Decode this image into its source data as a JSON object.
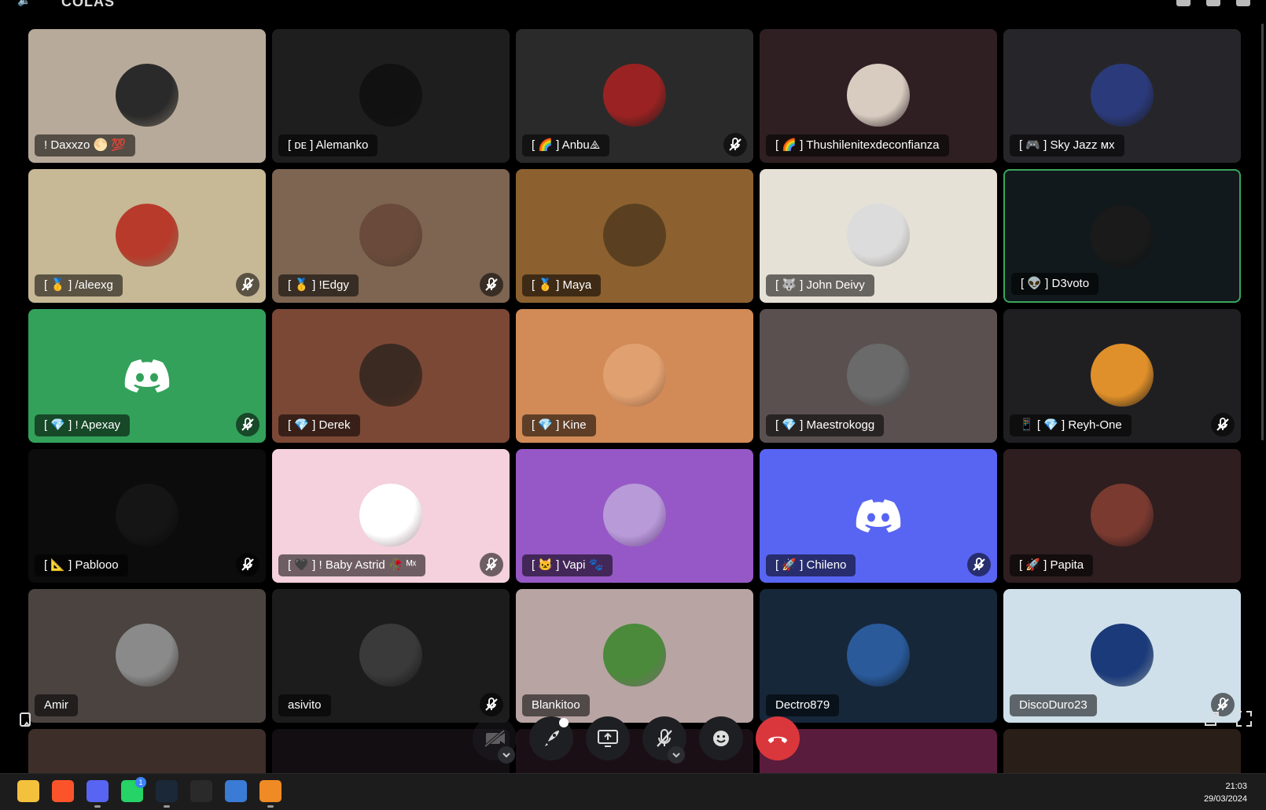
{
  "window": {
    "title": "COLAS"
  },
  "tiles": [
    {
      "name": "! Daxxzo 🌕 💯",
      "muted": false,
      "speaking": false,
      "bg": "#b8aa9a",
      "avatar_color": "#2a2a2a"
    },
    {
      "name": "[ ᴅᴇ ] Alemanko",
      "muted": false,
      "speaking": false,
      "bg": "#1e1e1e",
      "avatar_color": "#111111"
    },
    {
      "name": "[ 🌈 ] Anbu⧌",
      "muted": true,
      "speaking": false,
      "bg": "#2a2a2a",
      "avatar_color": "#9a2222"
    },
    {
      "name": "[ 🌈 ] Thushilenitexdeconfianza",
      "muted": false,
      "speaking": false,
      "bg": "#2f1f23",
      "avatar_color": "#d8ccc0"
    },
    {
      "name": "[ 🎮 ] Sky Jazz ᴍx",
      "muted": false,
      "speaking": false,
      "bg": "#26262a",
      "avatar_color": "#2b3a7a"
    },
    {
      "name": "[ 🥇 ] /aleexg",
      "muted": true,
      "speaking": false,
      "bg": "#c7b896",
      "avatar_color": "#b83a2a"
    },
    {
      "name": "[ 🥇 ] !Edgy",
      "muted": true,
      "speaking": false,
      "bg": "#7d6551",
      "avatar_color": "#6a4a3a"
    },
    {
      "name": "[ 🥇 ] Maya",
      "muted": false,
      "speaking": false,
      "bg": "#8c612f",
      "avatar_color": "#5a4020"
    },
    {
      "name": "[ 🐺 ] John Deivy",
      "muted": false,
      "speaking": false,
      "bg": "#e6e1d6",
      "avatar_color": "#dcdcdc"
    },
    {
      "name": "[ 👽 ] D3voto",
      "muted": false,
      "speaking": true,
      "bg": "#11191c",
      "avatar_color": "#1a1a1a"
    },
    {
      "name": "[ 💎 ] ! Apexay",
      "muted": true,
      "speaking": false,
      "bg": "#33a15a",
      "avatar_color": "discord"
    },
    {
      "name": "[ 💎 ] Derek",
      "muted": false,
      "speaking": false,
      "bg": "#7c4836",
      "avatar_color": "#3a2a22"
    },
    {
      "name": "[ 💎 ] Kine",
      "muted": false,
      "speaking": false,
      "bg": "#d28a57",
      "avatar_color": "#e0a070"
    },
    {
      "name": "[ 💎 ] Maestrokogg",
      "muted": false,
      "speaking": false,
      "bg": "#5a5050",
      "avatar_color": "#6a6a6a"
    },
    {
      "name": "📱 [ 💎 ] Reyh-One",
      "muted": true,
      "speaking": false,
      "bg": "#1f1f22",
      "avatar_color": "#e0902a"
    },
    {
      "name": "[ 📐 ] Pablooo",
      "muted": true,
      "speaking": false,
      "bg": "#0c0c0c",
      "avatar_color": "#151515"
    },
    {
      "name": "[ 🖤 ] ! Baby Astrid 🥀 ᴹˣ",
      "muted": true,
      "speaking": false,
      "bg": "#f4d1dc",
      "avatar_color": "#ffffff"
    },
    {
      "name": "[ 🐱 ] Vapi 🐾",
      "muted": false,
      "speaking": false,
      "bg": "#9658c6",
      "avatar_color": "#b89ad8"
    },
    {
      "name": "[ 🚀 ] Chileno",
      "muted": true,
      "speaking": false,
      "bg": "#5865f2",
      "avatar_color": "discord"
    },
    {
      "name": "[ 🚀 ] Papita",
      "muted": false,
      "speaking": false,
      "bg": "#2e1e20",
      "avatar_color": "#7a3a30"
    },
    {
      "name": "Amir",
      "muted": false,
      "speaking": false,
      "bg": "#4a4340",
      "avatar_color": "#8a8a8a"
    },
    {
      "name": "asivito",
      "muted": true,
      "speaking": false,
      "bg": "#1c1c1c",
      "avatar_color": "#3a3a3a"
    },
    {
      "name": "Blankitoo",
      "muted": false,
      "speaking": false,
      "bg": "#b7a4a3",
      "avatar_color": "#4a8a3a"
    },
    {
      "name": "Dectro879",
      "muted": false,
      "speaking": false,
      "bg": "#16273a",
      "avatar_color": "#2a5a9a"
    },
    {
      "name": "DiscoDuro23",
      "muted": true,
      "speaking": false,
      "bg": "#cfe0ea",
      "avatar_color": "#1a3a7a"
    }
  ],
  "bottom_row_colors": [
    "#3d2e2a",
    "#120e12",
    "#1a0f14",
    "#5a1c3c",
    "#2a1e18"
  ],
  "controls": [
    {
      "id": "camera",
      "label": "Camera off"
    },
    {
      "id": "activity",
      "label": "Activities"
    },
    {
      "id": "screenshare",
      "label": "Share screen"
    },
    {
      "id": "mic",
      "label": "Microphone muted"
    },
    {
      "id": "soundboard",
      "label": "Soundboard"
    },
    {
      "id": "disconnect",
      "label": "Disconnect"
    }
  ],
  "taskbar": {
    "apps": [
      "file-explorer",
      "brave",
      "discord",
      "whatsapp",
      "steam",
      "epic-games",
      "microsoft-store",
      "app-orange"
    ],
    "whatsapp_badge": "1",
    "time": "21:03",
    "date": "29/03/2024"
  }
}
